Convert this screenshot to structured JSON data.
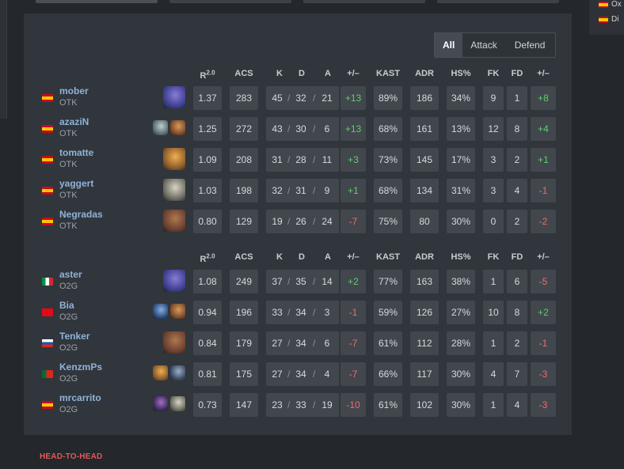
{
  "filter_tabs": [
    "All",
    "Attack",
    "Defend"
  ],
  "columns": {
    "rating": "R2.0",
    "acs": "ACS",
    "k": "K",
    "d": "D",
    "a": "A",
    "kd_diff": "+/–",
    "kast": "KAST",
    "adr": "ADR",
    "hs": "HS%",
    "fk": "FK",
    "fd": "FD",
    "fk_diff": "+/–"
  },
  "right_panel": [
    "Ox",
    "Di"
  ],
  "teams": [
    {
      "players": [
        {
          "name": "mober",
          "team": "OTK",
          "flag": "es",
          "agents": [
            "omen"
          ],
          "rating": "1.37",
          "acs": "283",
          "k": "45",
          "d": "32",
          "a": "21",
          "kd_diff": "+13",
          "kast": "89%",
          "adr": "186",
          "hs": "34%",
          "fk": "9",
          "fd": "1",
          "fk_diff": "+8"
        },
        {
          "name": "azaziN",
          "team": "OTK",
          "flag": "es",
          "agents": [
            "sage",
            "breach"
          ],
          "rating": "1.25",
          "acs": "272",
          "k": "43",
          "d": "30",
          "a": "6",
          "kd_diff": "+13",
          "kast": "68%",
          "adr": "161",
          "hs": "13%",
          "fk": "12",
          "fd": "8",
          "fk_diff": "+4"
        },
        {
          "name": "tomatte",
          "team": "OTK",
          "flag": "es",
          "agents": [
            "raze"
          ],
          "rating": "1.09",
          "acs": "208",
          "k": "31",
          "d": "28",
          "a": "11",
          "kd_diff": "+3",
          "kast": "73%",
          "adr": "145",
          "hs": "17%",
          "fk": "3",
          "fd": "2",
          "fk_diff": "+1"
        },
        {
          "name": "yaggert",
          "team": "OTK",
          "flag": "es",
          "agents": [
            "cypher"
          ],
          "rating": "1.03",
          "acs": "198",
          "k": "32",
          "d": "31",
          "a": "9",
          "kd_diff": "+1",
          "kast": "68%",
          "adr": "134",
          "hs": "31%",
          "fk": "3",
          "fd": "4",
          "fk_diff": "-1"
        },
        {
          "name": "Negradas",
          "team": "OTK",
          "flag": "es",
          "agents": [
            "brimstone"
          ],
          "rating": "0.80",
          "acs": "129",
          "k": "19",
          "d": "26",
          "a": "24",
          "kd_diff": "-7",
          "kast": "75%",
          "adr": "80",
          "hs": "30%",
          "fk": "0",
          "fd": "2",
          "fk_diff": "-2"
        }
      ]
    },
    {
      "players": [
        {
          "name": "aster",
          "team": "O2G",
          "flag": "it",
          "agents": [
            "omen"
          ],
          "rating": "1.08",
          "acs": "249",
          "k": "37",
          "d": "35",
          "a": "14",
          "kd_diff": "+2",
          "kast": "77%",
          "adr": "163",
          "hs": "38%",
          "fk": "1",
          "fd": "6",
          "fk_diff": "-5"
        },
        {
          "name": "Bia",
          "team": "O2G",
          "flag": "tr",
          "agents": [
            "jett",
            "breach"
          ],
          "rating": "0.94",
          "acs": "196",
          "k": "33",
          "d": "34",
          "a": "3",
          "kd_diff": "-1",
          "kast": "59%",
          "adr": "126",
          "hs": "27%",
          "fk": "10",
          "fd": "8",
          "fk_diff": "+2"
        },
        {
          "name": "Tenker",
          "team": "O2G",
          "flag": "ru",
          "agents": [
            "brimstone"
          ],
          "rating": "0.84",
          "acs": "179",
          "k": "27",
          "d": "34",
          "a": "6",
          "kd_diff": "-7",
          "kast": "61%",
          "adr": "112",
          "hs": "28%",
          "fk": "1",
          "fd": "2",
          "fk_diff": "-1"
        },
        {
          "name": "KenzmPs",
          "team": "O2G",
          "flag": "pt",
          "agents": [
            "raze",
            "sova"
          ],
          "rating": "0.81",
          "acs": "175",
          "k": "27",
          "d": "34",
          "a": "4",
          "kd_diff": "-7",
          "kast": "66%",
          "adr": "117",
          "hs": "30%",
          "fk": "4",
          "fd": "7",
          "fk_diff": "-3"
        },
        {
          "name": "mrcarrito",
          "team": "O2G",
          "flag": "es",
          "agents": [
            "reyna",
            "cypher"
          ],
          "rating": "0.73",
          "acs": "147",
          "k": "23",
          "d": "33",
          "a": "19",
          "kd_diff": "-10",
          "kast": "61%",
          "adr": "102",
          "hs": "30%",
          "fk": "1",
          "fd": "4",
          "fk_diff": "-3"
        }
      ]
    }
  ],
  "footer_link": "HEAD-TO-HEAD",
  "colors": {
    "positive": "#5fcf6a",
    "negative": "#f06a6a",
    "name": "#8fb3d9",
    "accent": "#e05a5a"
  }
}
